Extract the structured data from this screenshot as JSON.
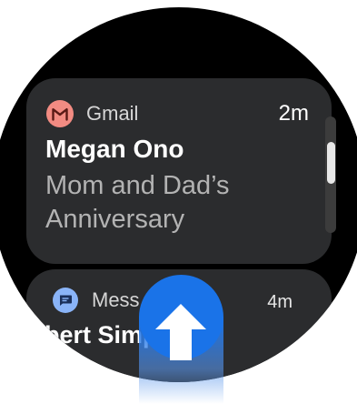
{
  "notifications": [
    {
      "app": "Gmail",
      "time": "2m",
      "sender": "Megan Ono",
      "body": "Mom and Dad’s Anniversary",
      "icon": "gmail-icon",
      "icon_color": "#f28b82"
    },
    {
      "app": "Mess",
      "time": "4m",
      "sender": "bert Simpson",
      "icon": "messages-icon",
      "icon_color": "#8ab4f8"
    }
  ],
  "swipe_hint": {
    "icon": "arrow-up-icon",
    "color": "#1a73e8"
  },
  "colors": {
    "background": "#000000",
    "card": "#2b2c2e"
  }
}
